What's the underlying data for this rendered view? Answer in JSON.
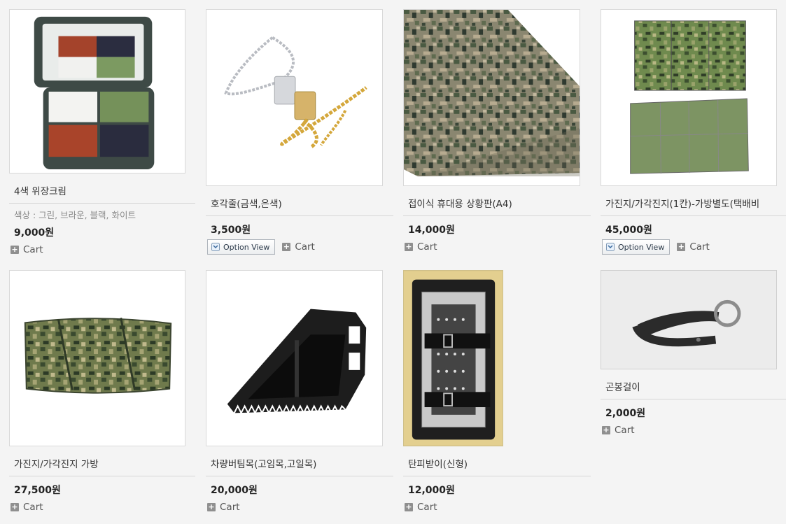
{
  "products": [
    {
      "name": "4색 위장크림",
      "description": "색상 : 그린, 브라운, 블랙, 화이트",
      "price": "9,000원",
      "cart_label": "Cart",
      "image": "camouflage-face-paint-compact"
    },
    {
      "name": "호각줄(금색,은색)",
      "price": "3,500원",
      "option_label": "Option View",
      "cart_label": "Cart",
      "image": "whistle-chain-silver-gold"
    },
    {
      "name": "접이식 휴대용 상황판(A4)",
      "price": "14,000원",
      "cart_label": "Cart",
      "image": "folding-camo-situation-board"
    },
    {
      "name": "가진지/가각진지(1칸)-가방별도(택배비",
      "price": "45,000원",
      "option_label": "Option View",
      "cart_label": "Cart",
      "image": "folding-camo-panel-screen"
    },
    {
      "name": "가진지/가각진지 가방",
      "price": "27,500원",
      "cart_label": "Cart",
      "image": "camo-carry-bag"
    },
    {
      "name": "차량버팀목(고임목,고일목)",
      "price": "20,000원",
      "cart_label": "Cart",
      "image": "rubber-wheel-chock"
    },
    {
      "name": "탄피받이(신형)",
      "price": "12,000원",
      "cart_label": "Cart",
      "image": "shell-casing-catcher"
    },
    {
      "name": "곤봉걸이",
      "price": "2,000원",
      "cart_label": "Cart",
      "image": "baton-holder-strap-ring"
    }
  ],
  "colors": {
    "background": "#f4f4f4",
    "price_text": "#222222",
    "description_text": "#8a8a8a"
  }
}
